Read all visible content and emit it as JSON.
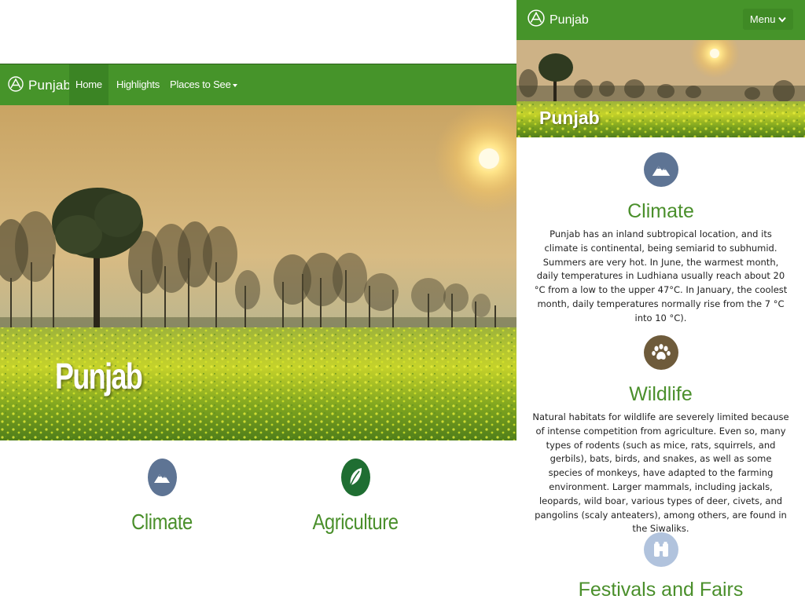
{
  "desktop": {
    "brand": "Punjab",
    "nav": {
      "home": "Home",
      "highlights": "Highlights",
      "places": "Places to See"
    },
    "hero_title": "Punjab",
    "features": [
      {
        "title": "Climate",
        "icon": "mountain-icon",
        "color": "#5e7494"
      },
      {
        "title": "Agriculture",
        "icon": "leaf-icon",
        "color": "#1f6e32"
      }
    ]
  },
  "mobile": {
    "brand": "Punjab",
    "menu_label": "Menu",
    "hero_title": "Punjab",
    "sections": [
      {
        "title": "Climate",
        "icon": "mountain-icon",
        "color": "#5e7494",
        "body": "Punjab has an inland subtropical location, and its climate is continental, being semiarid to subhumid. Summers are very hot. In June, the warmest month, daily temperatures in Ludhiana usually reach about 20 °C from a low to the upper 47°C. In January, the coolest month, daily temperatures normally rise from the 7 °C into 10 °C)."
      },
      {
        "title": "Wildlife",
        "icon": "paw-icon",
        "color": "#6e5b3b",
        "body": "Natural habitats for wildlife are severely limited because of intense competition from agriculture. Even so, many types of rodents (such as mice, rats, squirrels, and gerbils), bats, birds, and snakes, as well as some species of monkeys, have adapted to the farming environment. Larger mammals, including jackals, leopards, wild boar, various types of deer, civets, and pangolins (scaly anteaters), among others, are found in the Siwaliks."
      },
      {
        "title": "Festivals and Fairs",
        "icon": "binoculars-icon",
        "color": "#b1c3dd"
      }
    ]
  },
  "colors": {
    "nav_green": "#46942a",
    "title_green": "#4a8f2b"
  }
}
